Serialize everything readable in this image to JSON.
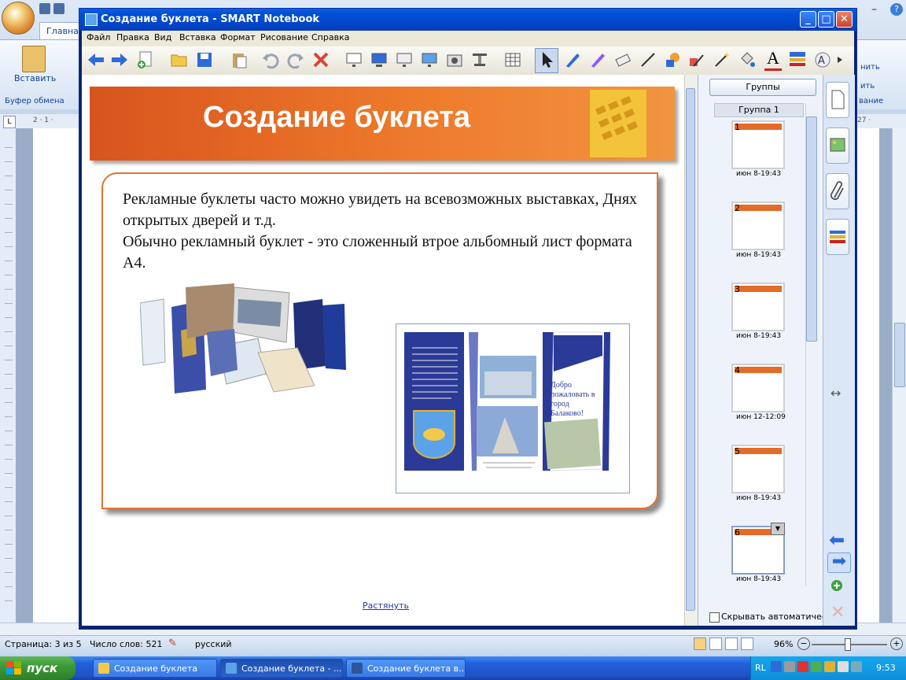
{
  "word": {
    "home_tab": "Главная",
    "paste_label": "Вставить",
    "clipboard_group": "Буфер обмена",
    "ribbon_right": [
      "нить",
      "ить",
      "вание"
    ],
    "ruler_left_num": "2 · 1 ·",
    "ruler_right_num": "27 ·",
    "status": {
      "page": "Страница: 3 из 5",
      "words": "Число слов: 521",
      "language": "русский",
      "zoom": "96%"
    }
  },
  "notebook": {
    "window_title": "Создание буклета - SMART Notebook",
    "menu": [
      "Файл",
      "Правка",
      "Вид",
      "Вставка",
      "Формат",
      "Рисование",
      "Справка"
    ],
    "slide": {
      "title": "Создание буклета",
      "paragraph1": "Рекламные буклеты часто можно увидеть на всевозможных выставках, Днях открытых дверей и т.д.",
      "paragraph2": "Обычно рекламный буклет - это сложенный втрое альбомный лист формата А4.",
      "booklet_welcome": "Добро пожаловать в город Балаково!"
    },
    "stretch_link": "Растянуть",
    "sidebar": {
      "groups_button": "Группы",
      "group_label": "Группа 1",
      "thumbnails": [
        {
          "num": "1",
          "date": "июн 8-19:43"
        },
        {
          "num": "2",
          "date": "июн 8-19:43"
        },
        {
          "num": "3",
          "date": "июн 8-19:43"
        },
        {
          "num": "4",
          "date": "июн 12-12:09"
        },
        {
          "num": "5",
          "date": "июн 8-19:43"
        },
        {
          "num": "6",
          "date": "июн 8-19:43"
        }
      ],
      "autohide_label": "Скрывать автоматическ"
    }
  },
  "taskbar": {
    "start": "пуск",
    "tasks": [
      "Создание буклета",
      "Создание буклета - ...",
      "Создание буклета в..."
    ],
    "lang": "RL",
    "clock": "9:53"
  },
  "colors": {
    "slide_orange": "#e06528",
    "xp_blue": "#0050d6",
    "start_green": "#3c9a36"
  }
}
